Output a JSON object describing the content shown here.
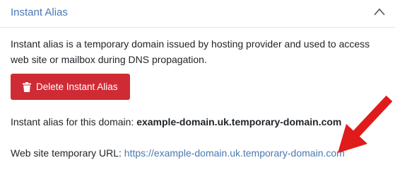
{
  "panel": {
    "title": "Instant Alias",
    "description": "Instant alias is a temporary domain issued by hosting provider and used to access web site or mailbox during DNS propagation."
  },
  "actions": {
    "delete_label": "Delete Instant Alias"
  },
  "alias": {
    "label": "Instant alias for this domain:",
    "value": "example-domain.uk.temporary-domain.com"
  },
  "temp_url": {
    "label": "Web site temporary URL:",
    "url": "https://example-domain.uk.temporary-domain.com"
  },
  "colors": {
    "accent": "#4a78b0",
    "danger": "#cf2b35",
    "annotation_arrow": "#e01b1b"
  },
  "icons": {
    "collapse": "chevron-up-icon",
    "delete": "trash-icon",
    "annotation": "red-arrow"
  }
}
